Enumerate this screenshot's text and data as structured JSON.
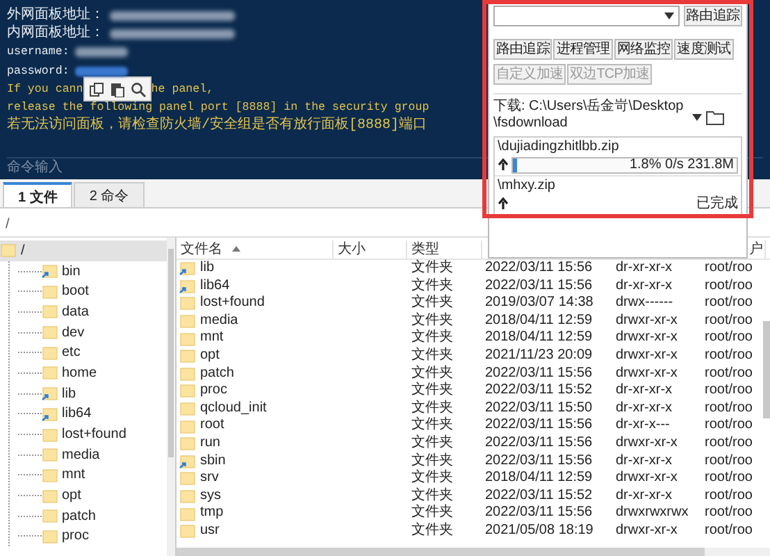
{
  "terminal": {
    "lines": [
      {
        "kind": "info",
        "text": "外网面板地址：",
        "redacted": true,
        "selected": false
      },
      {
        "kind": "info",
        "text": "内网面板地址：",
        "redacted": true,
        "selected": false
      },
      {
        "kind": "info",
        "text": "username:",
        "redacted": true,
        "selected": false
      },
      {
        "kind": "info",
        "text": "password:",
        "redacted": true,
        "selected": true
      },
      {
        "kind": "warn",
        "text": "If you cann",
        "text_after": "he panel,",
        "redacted": false,
        "selected": false
      },
      {
        "kind": "warn",
        "text": "release the following panel port [8888] in the security group",
        "redacted": false,
        "selected": false
      },
      {
        "kind": "warn",
        "text": "若无法访问面板，请检查防火墙/安全组是否有放行面板[8888]端口",
        "redacted": false,
        "selected": false
      }
    ],
    "input_placeholder": "命令输入"
  },
  "panel": {
    "route_button": "路由追踪",
    "tools": [
      {
        "label": "路由追踪",
        "disabled": false
      },
      {
        "label": "进程管理",
        "disabled": false
      },
      {
        "label": "网络监控",
        "disabled": false
      },
      {
        "label": "速度测试",
        "disabled": false
      },
      {
        "label": "自定义加速",
        "disabled": true
      },
      {
        "label": "双边TCP加速",
        "disabled": true
      }
    ],
    "download_label": "下载: C:\\Users\\岳金岢\\Desktop\\fsdownload",
    "transfers": [
      {
        "name": "\\dujiadingzhitlbb.zip",
        "kind": "progress",
        "level": 0.018,
        "reading": "1.8% 0/s 231.8M"
      },
      {
        "name": "\\mhxy.zip",
        "kind": "done",
        "reading": "已完成"
      }
    ]
  },
  "tabs": [
    {
      "label": "1 文件",
      "selected": true
    },
    {
      "label": "2 命令",
      "selected": false
    }
  ],
  "path": "/",
  "tree": {
    "label": "/",
    "selected": true,
    "children": [
      {
        "label": "bin",
        "link": true
      },
      {
        "label": "boot",
        "link": false
      },
      {
        "label": "data",
        "link": false
      },
      {
        "label": "dev",
        "link": false
      },
      {
        "label": "etc",
        "link": false
      },
      {
        "label": "home",
        "link": false
      },
      {
        "label": "lib",
        "link": true
      },
      {
        "label": "lib64",
        "link": true
      },
      {
        "label": "lost+found",
        "link": false
      },
      {
        "label": "media",
        "link": false
      },
      {
        "label": "mnt",
        "link": false
      },
      {
        "label": "opt",
        "link": false
      },
      {
        "label": "patch",
        "link": false
      },
      {
        "label": "proc",
        "link": false
      }
    ]
  },
  "files": {
    "columns": [
      "文件名",
      "大小",
      "类型",
      "",
      "",
      "户"
    ],
    "rows": [
      {
        "name": "lib",
        "link": true,
        "type": "文件夹",
        "modified": "2022/03/11 15:56",
        "perms": "dr-xr-xr-x",
        "owner": "root/roo"
      },
      {
        "name": "lib64",
        "link": true,
        "type": "文件夹",
        "modified": "2022/03/11 15:56",
        "perms": "dr-xr-xr-x",
        "owner": "root/roo"
      },
      {
        "name": "lost+found",
        "link": false,
        "type": "文件夹",
        "modified": "2019/03/07 14:38",
        "perms": "drwx------",
        "owner": "root/roo"
      },
      {
        "name": "media",
        "link": false,
        "type": "文件夹",
        "modified": "2018/04/11 12:59",
        "perms": "drwxr-xr-x",
        "owner": "root/roo"
      },
      {
        "name": "mnt",
        "link": false,
        "type": "文件夹",
        "modified": "2018/04/11 12:59",
        "perms": "drwxr-xr-x",
        "owner": "root/roo"
      },
      {
        "name": "opt",
        "link": false,
        "type": "文件夹",
        "modified": "2021/11/23 20:09",
        "perms": "drwxr-xr-x",
        "owner": "root/roo"
      },
      {
        "name": "patch",
        "link": false,
        "type": "文件夹",
        "modified": "2022/03/11 15:56",
        "perms": "drwxr-xr-x",
        "owner": "root/roo"
      },
      {
        "name": "proc",
        "link": false,
        "type": "文件夹",
        "modified": "2022/03/11 15:52",
        "perms": "dr-xr-xr-x",
        "owner": "root/roo"
      },
      {
        "name": "qcloud_init",
        "link": false,
        "type": "文件夹",
        "modified": "2022/03/11 15:50",
        "perms": "dr-xr-xr-x",
        "owner": "root/roo"
      },
      {
        "name": "root",
        "link": false,
        "type": "文件夹",
        "modified": "2022/03/11 15:56",
        "perms": "dr-xr-x---",
        "owner": "root/roo"
      },
      {
        "name": "run",
        "link": false,
        "type": "文件夹",
        "modified": "2022/03/11 15:56",
        "perms": "drwxr-xr-x",
        "owner": "root/roo"
      },
      {
        "name": "sbin",
        "link": true,
        "type": "文件夹",
        "modified": "2022/03/11 15:56",
        "perms": "dr-xr-xr-x",
        "owner": "root/roo"
      },
      {
        "name": "srv",
        "link": false,
        "type": "文件夹",
        "modified": "2018/04/11 12:59",
        "perms": "drwxr-xr-x",
        "owner": "root/roo"
      },
      {
        "name": "sys",
        "link": false,
        "type": "文件夹",
        "modified": "2022/03/11 15:52",
        "perms": "dr-xr-xr-x",
        "owner": "root/roo"
      },
      {
        "name": "tmp",
        "link": false,
        "type": "文件夹",
        "modified": "2022/03/11 15:56",
        "perms": "drwxrwxrwx",
        "owner": "root/roo"
      },
      {
        "name": "usr",
        "link": false,
        "type": "文件夹",
        "modified": "2021/05/08 18:19",
        "perms": "drwxr-xr-x",
        "owner": "root/roo"
      }
    ]
  }
}
